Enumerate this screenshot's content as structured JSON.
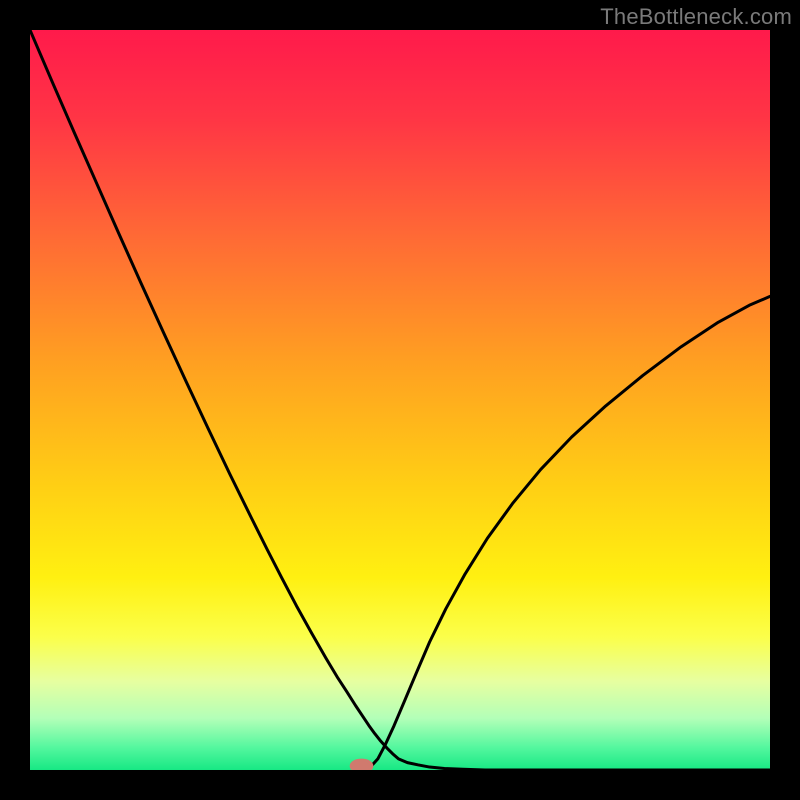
{
  "watermark": "TheBottleneck.com",
  "chart_data": {
    "type": "line",
    "title": "",
    "xlabel": "",
    "ylabel": "",
    "xlim": [
      0,
      1
    ],
    "ylim": [
      0,
      1
    ],
    "background": {
      "type": "vertical-gradient",
      "stops": [
        {
          "offset": 0.0,
          "color": "#ff1a4b"
        },
        {
          "offset": 0.12,
          "color": "#ff3545"
        },
        {
          "offset": 0.28,
          "color": "#ff6a35"
        },
        {
          "offset": 0.45,
          "color": "#ffa021"
        },
        {
          "offset": 0.62,
          "color": "#ffd014"
        },
        {
          "offset": 0.74,
          "color": "#fff011"
        },
        {
          "offset": 0.82,
          "color": "#fbff4a"
        },
        {
          "offset": 0.88,
          "color": "#e7ffa0"
        },
        {
          "offset": 0.93,
          "color": "#b3ffb8"
        },
        {
          "offset": 0.97,
          "color": "#53f79e"
        },
        {
          "offset": 1.0,
          "color": "#17e884"
        }
      ]
    },
    "series": [
      {
        "name": "bottleneck-curve",
        "color": "#000000",
        "x": [
          0.0,
          0.03,
          0.06,
          0.09,
          0.12,
          0.15,
          0.18,
          0.21,
          0.24,
          0.27,
          0.3,
          0.32,
          0.34,
          0.36,
          0.38,
          0.4,
          0.415,
          0.428,
          0.44,
          0.45,
          0.458,
          0.466,
          0.474,
          0.482,
          0.49,
          0.498,
          0.51,
          0.524,
          0.54,
          0.56,
          0.585,
          0.615,
          0.65,
          0.69,
          0.735,
          0.785,
          0.84,
          0.9,
          0.96,
          1.0
        ],
        "y": [
          1.0,
          0.93,
          0.861,
          0.793,
          0.725,
          0.658,
          0.592,
          0.527,
          0.463,
          0.4,
          0.339,
          0.299,
          0.26,
          0.222,
          0.186,
          0.151,
          0.126,
          0.106,
          0.087,
          0.072,
          0.06,
          0.049,
          0.039,
          0.03,
          0.022,
          0.015,
          0.01,
          0.007,
          0.004,
          0.002,
          0.001,
          0.0,
          0.0,
          0.0,
          0.0,
          0.0,
          0.0,
          0.0,
          0.0,
          0.0
        ]
      },
      {
        "name": "bottleneck-curve-right",
        "color": "#000000",
        "x": [
          0.45,
          0.46,
          0.47,
          0.48,
          0.492,
          0.506,
          0.522,
          0.54,
          0.562,
          0.588,
          0.618,
          0.652,
          0.69,
          0.732,
          0.778,
          0.828,
          0.88,
          0.93,
          0.972,
          1.0
        ],
        "y": [
          0.0,
          0.004,
          0.015,
          0.034,
          0.06,
          0.093,
          0.131,
          0.173,
          0.218,
          0.265,
          0.313,
          0.36,
          0.406,
          0.45,
          0.492,
          0.533,
          0.572,
          0.605,
          0.628,
          0.64
        ]
      }
    ],
    "marker": {
      "x": 0.448,
      "y": 0.0,
      "rx": 0.016,
      "ry": 0.01,
      "fill": "#d07a6e"
    }
  }
}
